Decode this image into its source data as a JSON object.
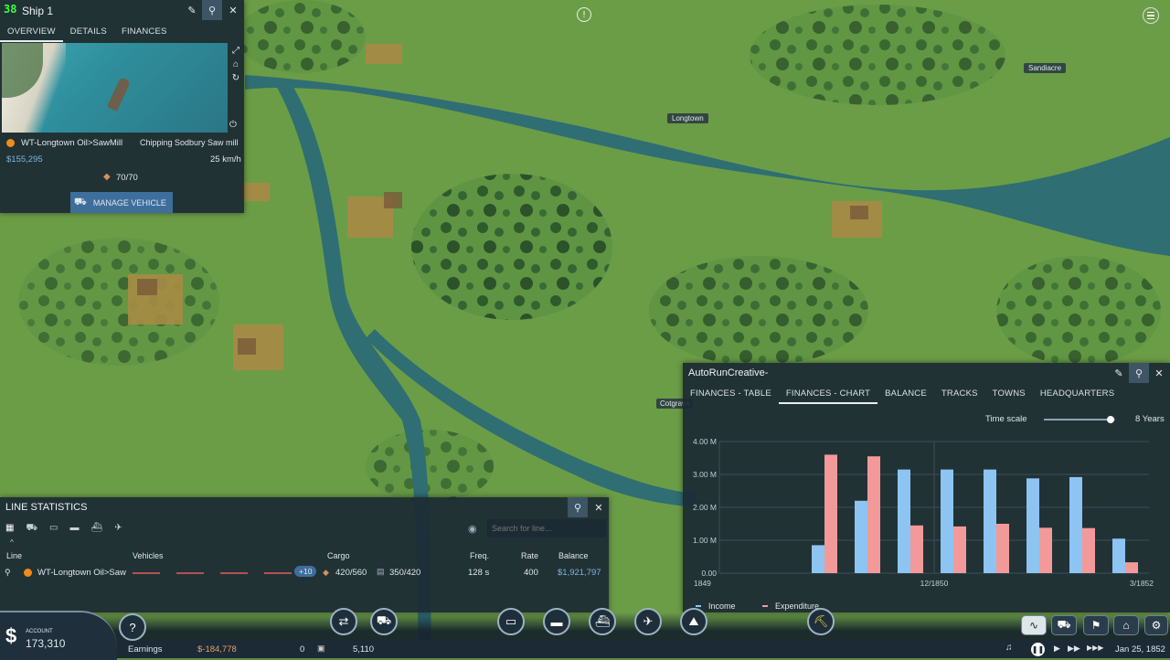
{
  "top_right_icon": "menu-icon",
  "map_labels": {
    "longtown": "Longtown",
    "sandiacre": "Sandiacre",
    "cotgrave": "Cotgrave"
  },
  "vehicle": {
    "title": "Ship 1",
    "fps_overlay": "38",
    "tabs": [
      "OVERVIEW",
      "DETAILS",
      "FINANCES"
    ],
    "line_name": "WT-Longtown Oil>SawMill",
    "status": "Chipping Sodbury Saw mill",
    "profit": "$155,295",
    "speed": "25 km/h",
    "capacity": "70/70",
    "manage_label": "MANAGE VEHICLE"
  },
  "company": {
    "title": "AutoRunCreative-",
    "tabs": [
      "FINANCES - TABLE",
      "FINANCES - CHART",
      "BALANCE",
      "TRACKS",
      "TOWNS",
      "HEADQUARTERS"
    ],
    "active_tab": 1,
    "time_scale_label": "Time scale",
    "time_scale_value": "8 Years",
    "time_scale_fraction": 0.94
  },
  "chart_data": {
    "type": "bar",
    "yticks": [
      "4.00 M",
      "3.00 M",
      "2.00 M",
      "1.00 M",
      "0.00"
    ],
    "xticks": [
      "1849",
      "12/1850",
      "3/1852"
    ],
    "ylim": [
      0,
      4000000
    ],
    "colors": {
      "income": "#8dc4f2",
      "expenditure": "#f29a9a"
    },
    "series": [
      {
        "name": "Income",
        "values": [
          850000,
          2200000,
          3150000,
          3150000,
          3150000,
          2880000,
          2920000,
          1050000
        ]
      },
      {
        "name": "Expenditure",
        "values": [
          3600000,
          3550000,
          1450000,
          1420000,
          1500000,
          1380000,
          1370000,
          330000
        ]
      }
    ],
    "legend_placement": "bottom"
  },
  "line_stats": {
    "title": "LINE STATISTICS",
    "search_placeholder": "Search for line...",
    "headers": [
      "Line",
      "Vehicles",
      "Cargo",
      "Freq.",
      "Rate",
      "Balance"
    ],
    "row": {
      "name": "WT-Longtown Oil>Saw",
      "extra_vehicles": "+10",
      "cargo1": "420/560",
      "cargo2": "350/420",
      "freq": "128 s",
      "rate": "400",
      "balance": "$1,921,797"
    }
  },
  "status_bar": {
    "account_label": "ACCOUNT",
    "account_value": "173,310",
    "earnings_label": "Earnings",
    "earnings_value": "$-184,778",
    "count1": "0",
    "count2": "5,110",
    "date": "Jan 25, 1852",
    "help_label": "?"
  }
}
